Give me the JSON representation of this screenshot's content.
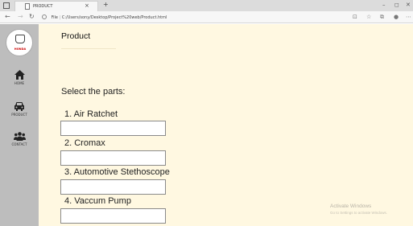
{
  "browser": {
    "tab_title": "PRODUCT",
    "tab_close": "×",
    "new_tab": "+",
    "url_prefix": "File",
    "url": "C:/Users/sony/Desktop/Project%20web/Product.html",
    "window_controls": [
      "–",
      "◻",
      "✕"
    ]
  },
  "sidebar": {
    "logo_text": "HONDA",
    "items": [
      {
        "label": "HOME",
        "icon": "home-icon"
      },
      {
        "label": "PRODUCT",
        "icon": "car-icon"
      },
      {
        "label": "CONTACT",
        "icon": "users-icon"
      }
    ]
  },
  "main": {
    "title": "Product",
    "select_label": "Select the parts:",
    "parts": [
      {
        "label": "1. Air Ratchet",
        "value": ""
      },
      {
        "label": "2. Cromax",
        "value": ""
      },
      {
        "label": "3. Automotive Stethoscope",
        "value": ""
      },
      {
        "label": "4. Vaccum Pump",
        "value": ""
      }
    ]
  },
  "watermark": {
    "line1": "Activate Windows",
    "line2": "Go to Settings to activate Windows."
  }
}
